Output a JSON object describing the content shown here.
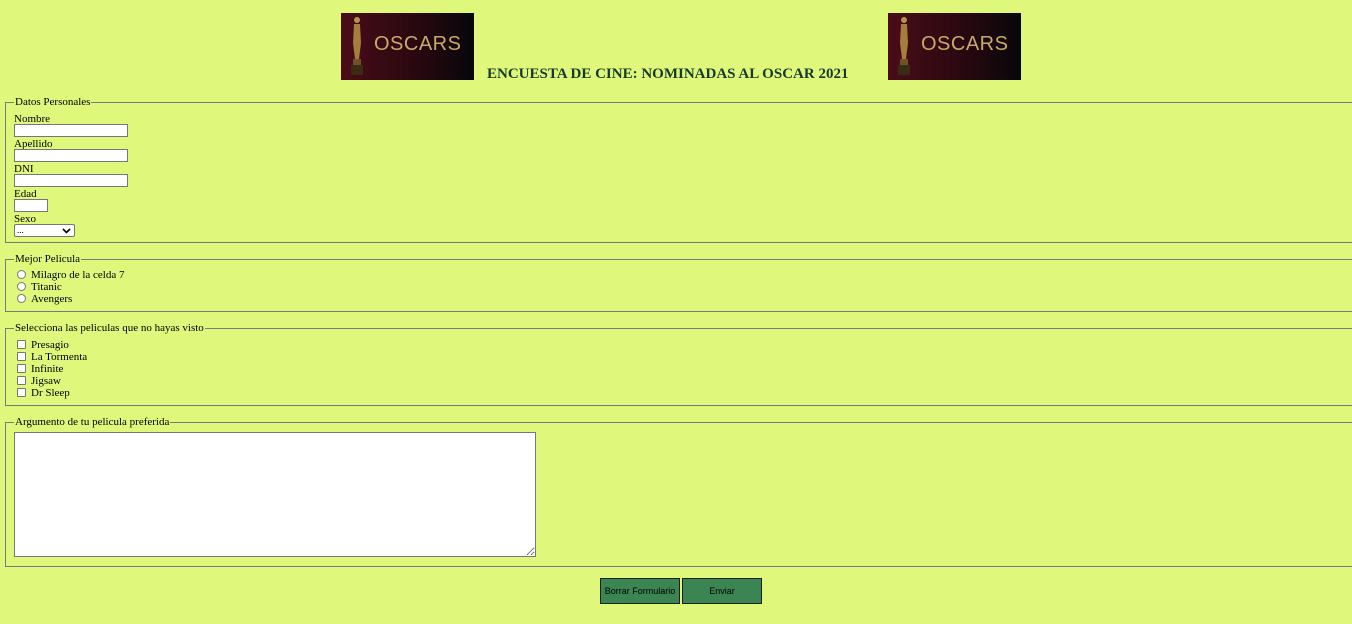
{
  "header": {
    "title": "ENCUESTA DE CINE: NOMINADAS AL OSCAR 2021",
    "logo_text": "OSCARS"
  },
  "personal": {
    "legend": "Datos Personales",
    "nombre_label": "Nombre",
    "nombre_value": "",
    "apellido_label": "Apellido",
    "apellido_value": "",
    "dni_label": "DNI",
    "dni_value": "",
    "edad_label": "Edad",
    "edad_value": "",
    "sexo_label": "Sexo",
    "sexo_selected": "..."
  },
  "best_movie": {
    "legend": "Mejor Pelicula",
    "options": [
      "Milagro de la celda 7",
      "Titanic",
      "Avengers"
    ]
  },
  "not_seen": {
    "legend": "Selecciona las peliculas que no hayas visto",
    "options": [
      "Presagio",
      "La Tormenta",
      "Infinite",
      "Jigsaw",
      "Dr Sleep"
    ]
  },
  "plot": {
    "legend": "Argumento de tu pelicula preferida",
    "value": ""
  },
  "buttons": {
    "reset_label": "Borrar Formulario",
    "submit_label": "Enviar"
  },
  "colors": {
    "background": "#dff87c",
    "button": "#3b8552",
    "title": "#153a2a"
  }
}
